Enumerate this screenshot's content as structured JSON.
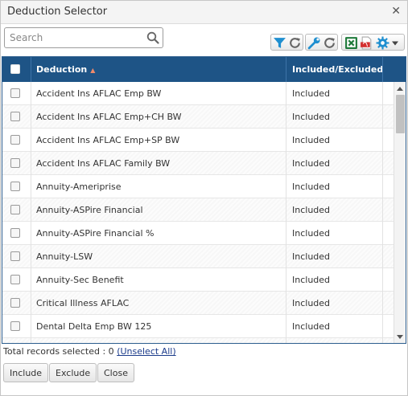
{
  "dialog": {
    "title": "Deduction Selector"
  },
  "search": {
    "placeholder": "Search",
    "value": ""
  },
  "grid": {
    "columns": {
      "deduction": "Deduction",
      "status": "Included/Excluded"
    },
    "rows": [
      {
        "deduction": "Accident Ins AFLAC Emp BW",
        "status": "Included"
      },
      {
        "deduction": "Accident Ins AFLAC Emp+CH BW",
        "status": "Included"
      },
      {
        "deduction": "Accident Ins AFLAC Emp+SP BW",
        "status": "Included"
      },
      {
        "deduction": "Accident Ins AFLAC Family BW",
        "status": "Included"
      },
      {
        "deduction": "Annuity-Ameriprise",
        "status": "Included"
      },
      {
        "deduction": "Annuity-ASPire Financial",
        "status": "Included"
      },
      {
        "deduction": "Annuity-ASPire Financial %",
        "status": "Included"
      },
      {
        "deduction": "Annuity-LSW",
        "status": "Included"
      },
      {
        "deduction": "Annuity-Sec Benefit",
        "status": "Included"
      },
      {
        "deduction": "Critical Illness AFLAC",
        "status": "Included"
      },
      {
        "deduction": "Dental Delta Emp BW 125",
        "status": "Included"
      }
    ]
  },
  "status_bar": {
    "text": "Total records selected : 0 ",
    "unselect_all": "(Unselect All)"
  },
  "buttons": {
    "include": "Include",
    "exclude": "Exclude",
    "close": "Close"
  },
  "icons": [
    "filter-icon",
    "refresh-icon",
    "wrench-icon",
    "refresh-icon",
    "excel-icon",
    "pdf-icon",
    "gear-icon",
    "dropdown-caret-icon",
    "search-icon",
    "close-icon"
  ],
  "colors": {
    "header_bg": "#1e5486",
    "header_text": "#ffffff",
    "sort_arrow": "#f08a6a",
    "link": "#1a3a8a"
  }
}
